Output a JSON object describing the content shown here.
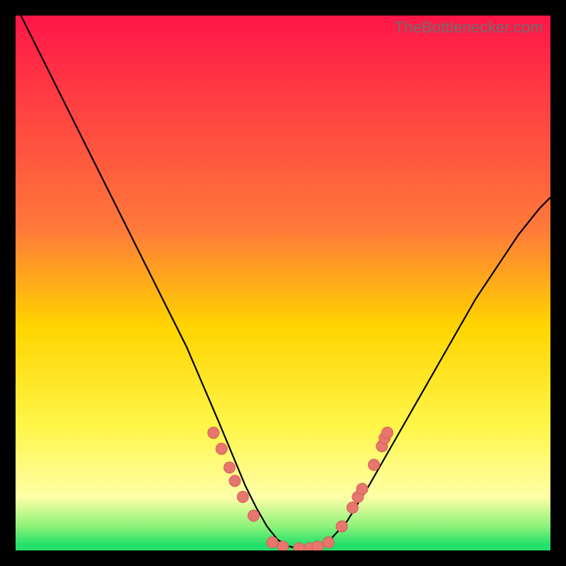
{
  "watermark": "TheBottlenecker.com",
  "colors": {
    "top": "#ff1648",
    "mid_upper": "#ff7a3a",
    "mid": "#ffd400",
    "mid_lower": "#fff64a",
    "pale": "#ffffa8",
    "green_light": "#8cf27a",
    "green": "#23e06a",
    "black": "#000000",
    "curve": "#000000",
    "dot_fill": "#e6766e",
    "dot_stroke": "#d85e57"
  },
  "chart_data": {
    "type": "line",
    "title": "",
    "xlabel": "",
    "ylabel": "",
    "xlim": [
      0,
      100
    ],
    "ylim": [
      0,
      100
    ],
    "series": [
      {
        "name": "curve",
        "x": [
          0,
          4,
          8,
          12,
          16,
          20,
          24,
          28,
          32,
          35,
          38,
          40.5,
          43,
          45,
          47,
          49,
          51,
          53,
          55,
          57,
          59,
          62,
          66,
          70,
          74,
          78,
          82,
          86,
          90,
          94,
          98,
          100
        ],
        "y": [
          102,
          94,
          86,
          78,
          70,
          62,
          54,
          46,
          38,
          31,
          24,
          18,
          12,
          8,
          4.5,
          2,
          0.8,
          0.3,
          0.3,
          0.8,
          2.2,
          5.5,
          12,
          19,
          26,
          33,
          40,
          47,
          53,
          59,
          64,
          66
        ]
      }
    ],
    "dots": [
      {
        "x": 37.0,
        "y": 22.0
      },
      {
        "x": 38.5,
        "y": 19.0
      },
      {
        "x": 40.0,
        "y": 15.5
      },
      {
        "x": 41.0,
        "y": 13.0
      },
      {
        "x": 42.5,
        "y": 10.0
      },
      {
        "x": 44.5,
        "y": 6.5
      },
      {
        "x": 48.0,
        "y": 1.5
      },
      {
        "x": 50.0,
        "y": 0.7
      },
      {
        "x": 53.0,
        "y": 0.4
      },
      {
        "x": 55.0,
        "y": 0.4
      },
      {
        "x": 56.5,
        "y": 0.7
      },
      {
        "x": 58.5,
        "y": 1.5
      },
      {
        "x": 61.0,
        "y": 4.5
      },
      {
        "x": 63.0,
        "y": 8.0
      },
      {
        "x": 64.0,
        "y": 10.0
      },
      {
        "x": 64.8,
        "y": 11.5
      },
      {
        "x": 67.0,
        "y": 16.0
      },
      {
        "x": 68.5,
        "y": 19.5
      },
      {
        "x": 69.0,
        "y": 21.0
      },
      {
        "x": 69.5,
        "y": 22.0
      }
    ],
    "gradient_stops": [
      {
        "offset": 0.0,
        "key": "top"
      },
      {
        "offset": 0.4,
        "key": "mid_upper"
      },
      {
        "offset": 0.58,
        "key": "mid"
      },
      {
        "offset": 0.77,
        "key": "mid_lower"
      },
      {
        "offset": 0.9,
        "key": "pale"
      },
      {
        "offset": 0.955,
        "key": "green_light"
      },
      {
        "offset": 0.99,
        "key": "green"
      },
      {
        "offset": 1.0,
        "key": "green"
      }
    ]
  }
}
